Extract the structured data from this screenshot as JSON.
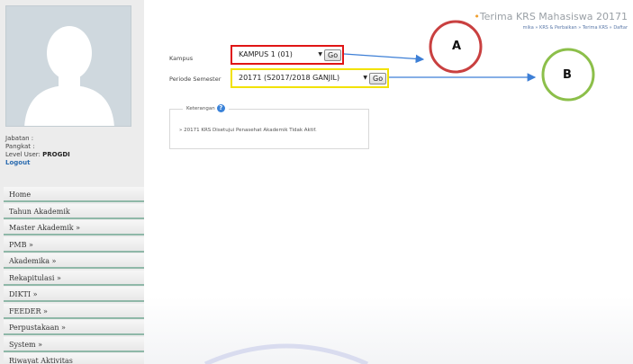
{
  "user": {
    "jabatan_label": "Jabatan :",
    "pangkat_label": "Pangkat :",
    "level_label": "Level User:",
    "level_value": "PROGDI",
    "logout": "Logout"
  },
  "menu": [
    {
      "label": "Home"
    },
    {
      "label": "Tahun Akademik"
    },
    {
      "label": "Master Akademik »"
    },
    {
      "label": "PMB »"
    },
    {
      "label": "Akademika »"
    },
    {
      "label": "Rekapitulasi »"
    },
    {
      "label": "DIKTI »"
    },
    {
      "label": "FEEDER »"
    },
    {
      "label": "Perpustakaan »"
    },
    {
      "label": "System »"
    },
    {
      "label": "Riwayat Aktivitas"
    }
  ],
  "header": {
    "title": "Terima KRS Mahasiswa 20171",
    "breadcrumb": "mika » KRS & Perbaikan » Terima KRS » Daftar"
  },
  "form": {
    "kampus_label": "Kampus",
    "kampus_value": "KAMPUS 1 (01)",
    "periode_label": "Periode Semester",
    "periode_value": "20171 (S2017/2018 GANJIL)",
    "go_label": "Go"
  },
  "keterangan": {
    "legend": "Keterangan",
    "text": "» 20171 KRS Disetujui Penasehat Akademik Tidak Aktif."
  },
  "annotations": {
    "a": "A",
    "b": "B",
    "color_a": "#c94040",
    "color_b": "#8cbf4a",
    "arrow_color": "#3d7fd6"
  },
  "colors": {
    "kampus_highlight": "#e01515",
    "periode_highlight": "#f2e200",
    "menu_border": "#8fb8a8"
  }
}
